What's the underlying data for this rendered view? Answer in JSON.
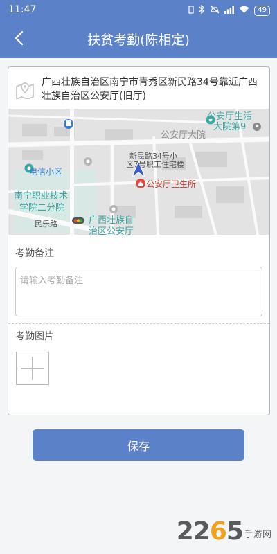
{
  "status_bar": {
    "time": "11:47",
    "battery": "49",
    "icons": [
      "sim-icon",
      "bluetooth-icon",
      "mute-icon",
      "signal-icon",
      "wifi-icon",
      "battery-icon"
    ]
  },
  "header": {
    "title": "扶贫考勤(陈相定)",
    "back_icon": "chevron-left-icon"
  },
  "location": {
    "icon": "map-icon",
    "address": "广西壮族自治区南宁市青秀区新民路34号靠近广西壮族自治区公安厅(旧厅)"
  },
  "map": {
    "labels": {
      "poi_top_right": "公安厅生活",
      "poi_top_right_2": "大院第9",
      "district": "公安厅大院",
      "telecom": "电信小区",
      "building_1": "新民路34号小",
      "building_2": "区7号职工住宅楼",
      "clinic": "公安厅卫生所",
      "school_1": "南宁职业技术",
      "school_2": "学院二分院",
      "road": "民乐路",
      "gov_1": "广西壮族自",
      "gov_2": "治区公安厅"
    }
  },
  "remark": {
    "label": "考勤备注",
    "placeholder": "请输入考勤备注",
    "value": ""
  },
  "photo": {
    "label": "考勤图片",
    "add_icon": "plus-icon"
  },
  "actions": {
    "save_label": "保存"
  },
  "watermark": {
    "number_main": "22",
    "number_accent": "6",
    "number_tail": "5",
    "text": "手游网"
  },
  "colors": {
    "primary": "#5b81c9",
    "background": "#f4f5f7",
    "map_teal": "#3aa8a4",
    "map_blue": "#3a7bd5",
    "clinic_red": "#e04a3f",
    "watermark_orange": "#f0a21e"
  }
}
